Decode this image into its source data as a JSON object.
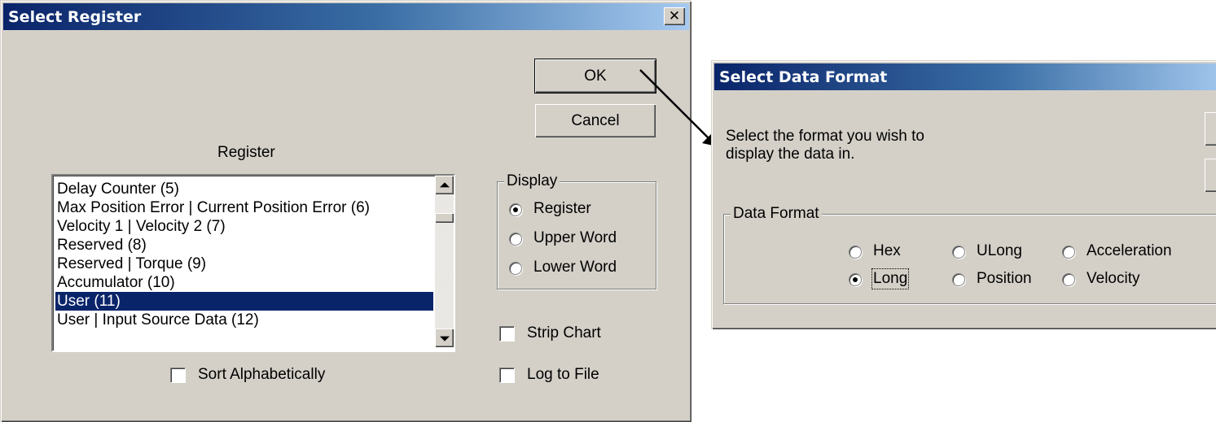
{
  "select_register": {
    "title": "Select Register",
    "close_glyph": "✕",
    "ok_label": "OK",
    "cancel_label": "Cancel",
    "register_label": "Register",
    "register_items": [
      "Delay Counter (5)",
      "Max Position Error | Current Position Error (6)",
      "Velocity 1 | Velocity 2 (7)",
      "Reserved (8)",
      "Reserved | Torque (9)",
      "Accumulator (10)",
      "User (11)",
      "User | Input Source Data (12)"
    ],
    "selected_register": "User (11)",
    "display_group": {
      "legend": "Display",
      "options": [
        "Register",
        "Upper Word",
        "Lower Word"
      ],
      "selected": "Register"
    },
    "strip_chart_label": "Strip Chart",
    "strip_chart_checked": false,
    "log_to_file_label": "Log to File",
    "log_to_file_checked": false,
    "sort_alphabetically_label": "Sort Alphabetically",
    "sort_alphabetically_checked": false
  },
  "select_data_format": {
    "title": "Select Data Format",
    "description_line1": "Select the format you wish to",
    "description_line2": "display the data in.",
    "group_legend": "Data Format",
    "options": [
      "Hex",
      "ULong",
      "Acceleration",
      "Long",
      "Position",
      "Velocity"
    ],
    "selected": "Long"
  },
  "colors": {
    "dialog_face": "#d4d0c8",
    "title_active": "#0a246a",
    "selection": "#0a246a"
  }
}
